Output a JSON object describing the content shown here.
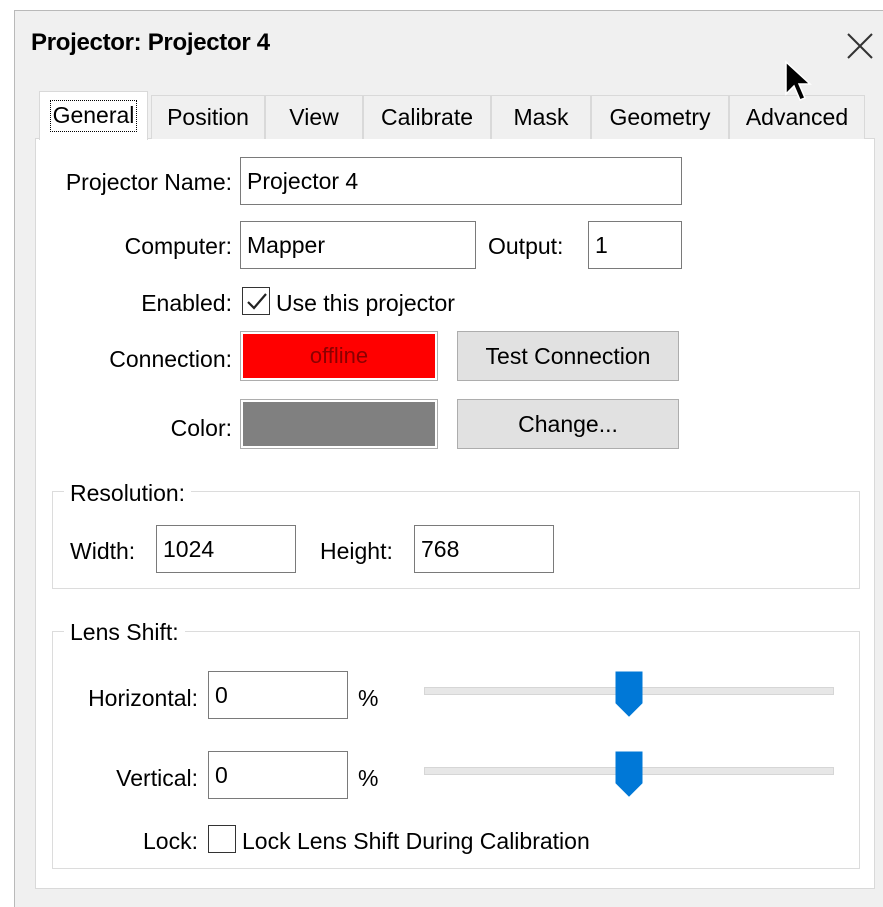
{
  "window": {
    "title": "Projector: Projector 4"
  },
  "tabs": [
    {
      "label": "General"
    },
    {
      "label": "Position"
    },
    {
      "label": "View"
    },
    {
      "label": "Calibrate"
    },
    {
      "label": "Mask"
    },
    {
      "label": "Geometry"
    },
    {
      "label": "Advanced"
    }
  ],
  "general": {
    "projector_name_label": "Projector Name:",
    "projector_name_value": "Projector 4",
    "computer_label": "Computer:",
    "computer_value": "Mapper",
    "output_label": "Output:",
    "output_value": "1",
    "enabled_label": "Enabled:",
    "enabled_checkbox_label": "Use this projector",
    "enabled_checked": true,
    "connection_label": "Connection:",
    "connection_status": "offline",
    "connection_status_color": "#ff0000",
    "connection_text_color": "#8b0000",
    "test_connection_label": "Test Connection",
    "color_label": "Color:",
    "projector_color": "#808080",
    "change_label": "Change..."
  },
  "resolution": {
    "title": "Resolution:",
    "width_label": "Width:",
    "width_value": "1024",
    "height_label": "Height:",
    "height_value": "768"
  },
  "lens_shift": {
    "title": "Lens Shift:",
    "horizontal_label": "Horizontal:",
    "horizontal_value": "0",
    "vertical_label": "Vertical:",
    "vertical_value": "0",
    "unit": "%",
    "lock_label": "Lock:",
    "lock_checkbox_label": "Lock Lens Shift During Calibration",
    "lock_checked": false,
    "slider_accent": "#0078d7",
    "horizontal_slider_fraction": 0.5,
    "vertical_slider_fraction": 0.5
  }
}
